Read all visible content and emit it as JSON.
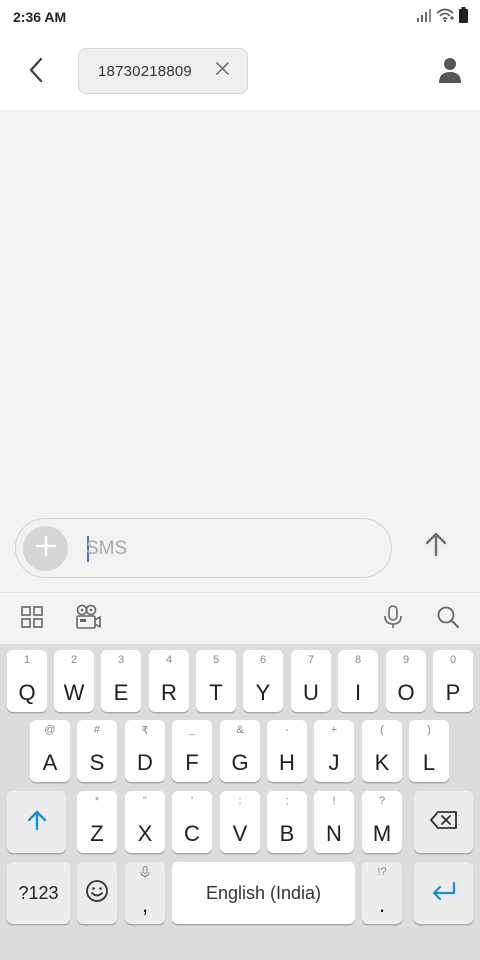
{
  "status_bar": {
    "time": "2:36 AM"
  },
  "header": {
    "recipient_number": "18730218809"
  },
  "compose": {
    "placeholder": "SMS"
  },
  "keyboard": {
    "row1": [
      {
        "main": "Q",
        "hint": "1"
      },
      {
        "main": "W",
        "hint": "2"
      },
      {
        "main": "E",
        "hint": "3"
      },
      {
        "main": "R",
        "hint": "4"
      },
      {
        "main": "T",
        "hint": "5"
      },
      {
        "main": "Y",
        "hint": "6"
      },
      {
        "main": "U",
        "hint": "7"
      },
      {
        "main": "I",
        "hint": "8"
      },
      {
        "main": "O",
        "hint": "9"
      },
      {
        "main": "P",
        "hint": "0"
      }
    ],
    "row2": [
      {
        "main": "A",
        "hint": "@"
      },
      {
        "main": "S",
        "hint": "#"
      },
      {
        "main": "D",
        "hint": "₹"
      },
      {
        "main": "F",
        "hint": "_"
      },
      {
        "main": "G",
        "hint": "&"
      },
      {
        "main": "H",
        "hint": "-"
      },
      {
        "main": "J",
        "hint": "+"
      },
      {
        "main": "K",
        "hint": "("
      },
      {
        "main": "L",
        "hint": ")"
      }
    ],
    "row3": [
      {
        "main": "Z",
        "hint": "*"
      },
      {
        "main": "X",
        "hint": "\""
      },
      {
        "main": "C",
        "hint": "'"
      },
      {
        "main": "V",
        "hint": ":"
      },
      {
        "main": "B",
        "hint": ";"
      },
      {
        "main": "N",
        "hint": "!"
      },
      {
        "main": "M",
        "hint": "?"
      }
    ],
    "symbols_label": "?123",
    "comma_label": ",",
    "space_label": "English (India)",
    "period_label": ".",
    "period_hint": "!?"
  }
}
